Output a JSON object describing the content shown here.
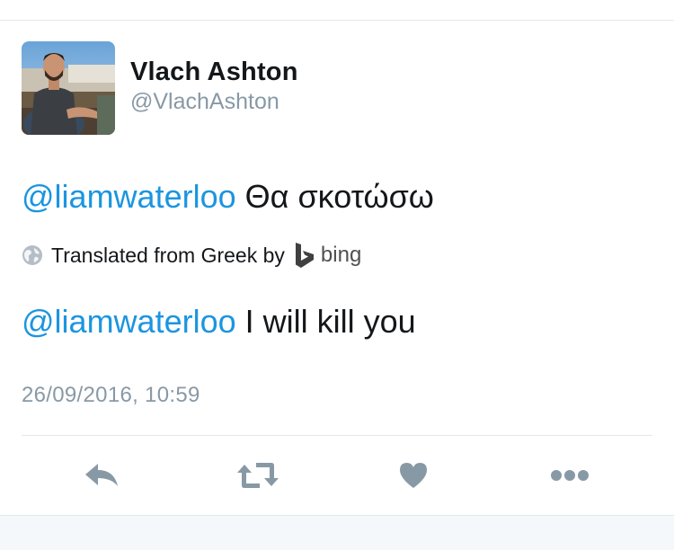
{
  "user": {
    "display_name": "Vlach Ashton",
    "handle": "@VlachAshton"
  },
  "tweet": {
    "original": {
      "mention": "@liamwaterloo",
      "text": "Θα σκοτώσω"
    },
    "translation_bar": {
      "label": "Translated from Greek by",
      "provider": "bing"
    },
    "translated": {
      "mention": "@liamwaterloo",
      "text": "I will kill you"
    },
    "timestamp": "26/09/2016, 10:59"
  },
  "actions": [
    "reply-icon",
    "retweet-icon",
    "like-icon",
    "more-icon"
  ],
  "colors": {
    "mention": "#1b95e0",
    "secondary_text": "#8899a6",
    "action_icon": "#8899a6",
    "divider": "#e1e8ed",
    "footer_background": "#f5f8fa"
  }
}
